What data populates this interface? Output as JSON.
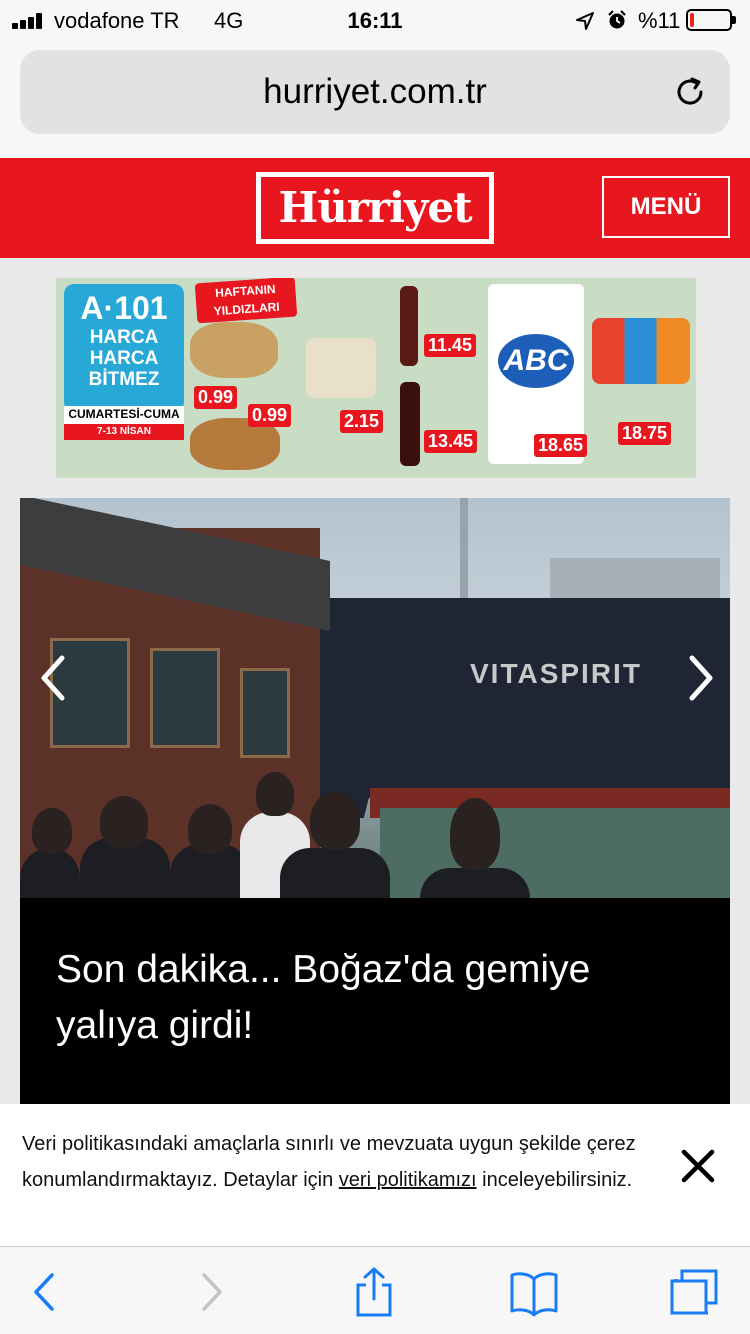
{
  "status_bar": {
    "carrier": "vodafone TR",
    "network": "4G",
    "time": "16:11",
    "battery_percent": "%11",
    "battery_level": 0.11,
    "icons": [
      "signal-icon",
      "location-icon",
      "alarm-icon",
      "battery-icon"
    ]
  },
  "browser": {
    "url": "hurriyet.com.tr",
    "reload_icon": "reload-icon"
  },
  "header": {
    "logo_text": "Hürriyet",
    "menu_label": "MENÜ",
    "brand_color": "#e8171f"
  },
  "ad": {
    "brand_name": "A·101",
    "slogan": "HARCA HARCA BİTMEZ",
    "days": "CUMARTESİ-CUMA",
    "dates": "7-13 NİSAN",
    "badge": "HAFTANIN YILDIZLARI",
    "product_brand": "ABC",
    "prices": [
      "0.99",
      "0.99",
      "2.15",
      "11.45",
      "13.45",
      "18.65",
      "18.75"
    ]
  },
  "news": {
    "headline": "Son dakika... Boğaz'da gemiye yalıya girdi!",
    "ship_name": "VITASPIRIT",
    "prev_icon": "chevron-left-icon",
    "next_icon": "chevron-right-icon"
  },
  "cookie": {
    "text_before": "Veri politikasındaki amaçlarla sınırlı ve mevzuata uygun şekilde çerez konumlandırmaktayız. Detaylar için ",
    "link_text": "veri politikamızı",
    "text_after": " inceleyebilirsiniz.",
    "close_icon": "close-icon"
  },
  "toolbar": {
    "buttons": [
      "back-icon",
      "forward-icon",
      "share-icon",
      "bookmarks-icon",
      "tabs-icon"
    ],
    "accent": "#1a7cf5"
  }
}
